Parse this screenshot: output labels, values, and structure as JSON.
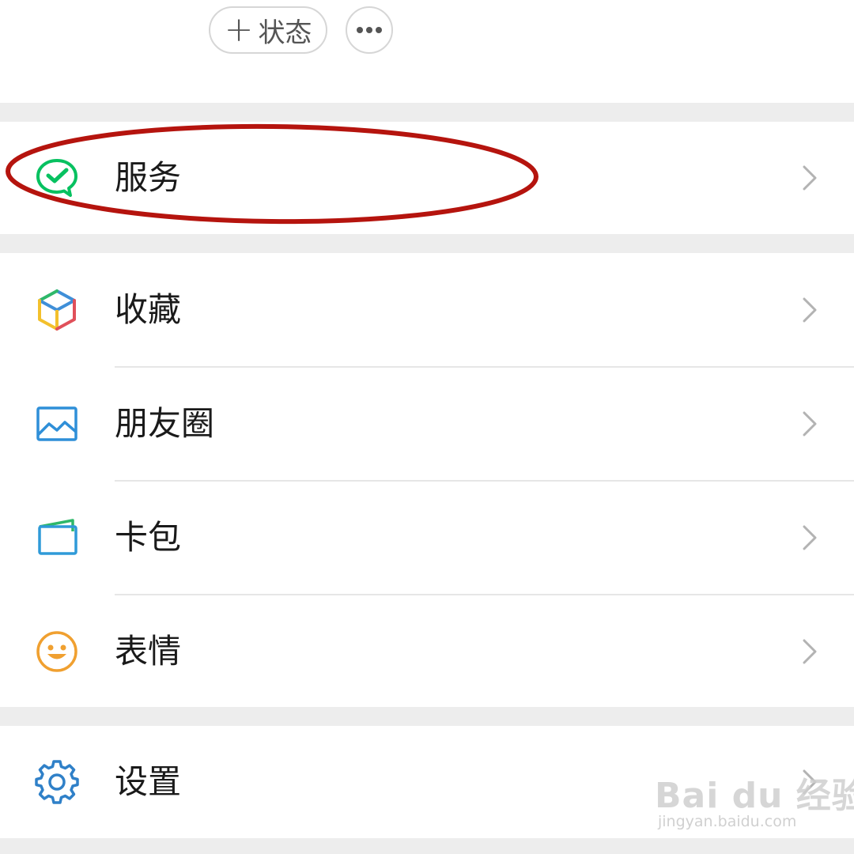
{
  "header": {
    "status_button_label": "状态",
    "status_button_icon": "plus-icon",
    "more_button_icon": "ellipsis-icon"
  },
  "menu_groups": [
    {
      "items": [
        {
          "label": "服务",
          "icon": "wechat-pay-check-icon",
          "icon_color": "#07c160"
        }
      ]
    },
    {
      "items": [
        {
          "label": "收藏",
          "icon": "cube-icon",
          "icon_color": "#3f8fd8"
        },
        {
          "label": "朋友圈",
          "icon": "picture-icon",
          "icon_color": "#2f8fd8"
        },
        {
          "label": "卡包",
          "icon": "card-wallet-icon",
          "icon_color": "#2f9ad8"
        },
        {
          "label": "表情",
          "icon": "smiley-icon",
          "icon_color": "#f0a030"
        }
      ]
    },
    {
      "items": [
        {
          "label": "设置",
          "icon": "gear-icon",
          "icon_color": "#2f80c8"
        }
      ]
    }
  ],
  "annotation": {
    "highlight_target": "服务",
    "color": "#b5140e",
    "shape": "ellipse"
  },
  "watermark": {
    "logo_text": "Bai du 经验",
    "url": "jingyan.baidu.com"
  },
  "colors": {
    "background": "#ededed",
    "row": "#ffffff",
    "text": "#1a1a1a",
    "chevron": "#b3b3b3"
  }
}
